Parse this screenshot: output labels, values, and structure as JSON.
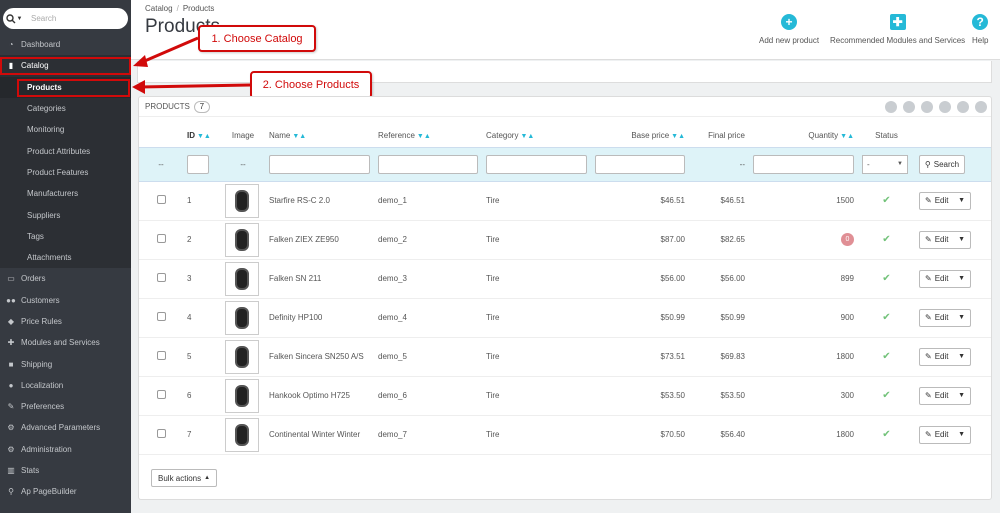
{
  "search": {
    "placeholder": "Search"
  },
  "sidebar": {
    "items": [
      {
        "label": "Dashboard",
        "icon": "dashboard-icon"
      },
      {
        "label": "Catalog",
        "icon": "book-icon"
      },
      {
        "label": "Orders",
        "icon": "credit-card-icon"
      },
      {
        "label": "Customers",
        "icon": "users-icon"
      },
      {
        "label": "Price Rules",
        "icon": "tag-icon"
      },
      {
        "label": "Modules and Services",
        "icon": "puzzle-icon"
      },
      {
        "label": "Shipping",
        "icon": "truck-icon"
      },
      {
        "label": "Localization",
        "icon": "globe-icon"
      },
      {
        "label": "Preferences",
        "icon": "wrench-icon"
      },
      {
        "label": "Advanced Parameters",
        "icon": "cogs-icon"
      },
      {
        "label": "Administration",
        "icon": "gear-icon"
      },
      {
        "label": "Stats",
        "icon": "bar-chart-icon"
      },
      {
        "label": "Ap PageBuilder",
        "icon": "link-icon"
      }
    ],
    "catalog_sub": [
      "Products",
      "Categories",
      "Monitoring",
      "Product Attributes",
      "Product Features",
      "Manufacturers",
      "Suppliers",
      "Tags",
      "Attachments"
    ]
  },
  "header": {
    "breadcrumb": [
      "Catalog",
      "Products"
    ],
    "title": "Products",
    "actions": [
      "Add new product",
      "Recommended Modules and Services",
      "Help"
    ]
  },
  "callouts": [
    "1. Choose Catalog",
    "2. Choose Products"
  ],
  "panel": {
    "heading": "Products",
    "count": "7",
    "columns": [
      "ID",
      "Image",
      "Name",
      "Reference",
      "Category",
      "Base price",
      "Final price",
      "Quantity",
      "Status"
    ],
    "filter_dash": "--",
    "filter_select": "-",
    "search_label": "Search",
    "edit_label": "Edit",
    "bulk_label": "Bulk actions",
    "rows": [
      {
        "id": "1",
        "name": "Starfire RS-C 2.0",
        "ref": "demo_1",
        "cat": "Tire",
        "base": "$46.51",
        "final": "$46.51",
        "qty": "1500"
      },
      {
        "id": "2",
        "name": "Falken ZIEX ZE950",
        "ref": "demo_2",
        "cat": "Tire",
        "base": "$87.00",
        "final": "$82.65",
        "qty": "0"
      },
      {
        "id": "3",
        "name": "Falken SN 211",
        "ref": "demo_3",
        "cat": "Tire",
        "base": "$56.00",
        "final": "$56.00",
        "qty": "899"
      },
      {
        "id": "4",
        "name": "Definity HP100",
        "ref": "demo_4",
        "cat": "Tire",
        "base": "$50.99",
        "final": "$50.99",
        "qty": "900"
      },
      {
        "id": "5",
        "name": "Falken Sincera SN250 A/S",
        "ref": "demo_5",
        "cat": "Tire",
        "base": "$73.51",
        "final": "$69.83",
        "qty": "1800"
      },
      {
        "id": "6",
        "name": "Hankook Optimo H725",
        "ref": "demo_6",
        "cat": "Tire",
        "base": "$53.50",
        "final": "$53.50",
        "qty": "300"
      },
      {
        "id": "7",
        "name": "Continental Winter Winter",
        "ref": "demo_7",
        "cat": "Tire",
        "base": "$70.50",
        "final": "$56.40",
        "qty": "1800"
      }
    ]
  },
  "colors": {
    "accent": "#25b9d7",
    "callout": "#d10a0a",
    "sidebar": "#363a41",
    "status_ok": "#72c279"
  }
}
